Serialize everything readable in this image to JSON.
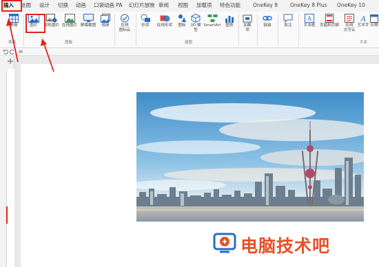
{
  "tabs": [
    {
      "label": "插入",
      "active": true
    },
    {
      "label": "绘图",
      "active": false
    },
    {
      "label": "设计",
      "active": false
    },
    {
      "label": "切换",
      "active": false
    },
    {
      "label": "动画",
      "active": false
    },
    {
      "label": "口袋动画 PA",
      "active": false
    },
    {
      "label": "幻灯片放映",
      "active": false
    },
    {
      "label": "审阅",
      "active": false
    },
    {
      "label": "视图",
      "active": false
    },
    {
      "label": "加载项",
      "active": false
    },
    {
      "label": "特色功能",
      "active": false
    },
    {
      "label": "OneKey 8",
      "active": false
    },
    {
      "label": "OneKey 8 Plus",
      "active": false
    },
    {
      "label": "OneKey 10",
      "active": false
    }
  ],
  "ribbon": {
    "buttons": [
      {
        "label": "表格",
        "icon": "table-icon"
      },
      {
        "label": "图片",
        "icon": "picture-icon"
      },
      {
        "label": "联机图片",
        "icon": "online-picture-icon"
      },
      {
        "label": "在线图片",
        "icon": "online-image-icon"
      },
      {
        "label": "屏幕截图",
        "icon": "screenshot-icon"
      },
      {
        "label": "相册",
        "icon": "album-icon"
      },
      {
        "label": "在线",
        "label2": "图标云",
        "icon": "icon-cloud-icon"
      },
      {
        "label": "形状",
        "icon": "shapes-icon"
      },
      {
        "label": "在线形状",
        "icon": "online-shapes-icon"
      },
      {
        "label": "图标",
        "icon": "icons-icon"
      },
      {
        "label": "3D 模",
        "label2": "型",
        "icon": "3d-model-icon"
      },
      {
        "label": "SmartArt",
        "icon": "smartart-icon"
      },
      {
        "label": "图表",
        "icon": "chart-icon"
      },
      {
        "label": "加载",
        "label2": "项",
        "icon": "addin-icon"
      },
      {
        "label": "链接",
        "icon": "link-icon"
      },
      {
        "label": "批注",
        "icon": "comment-icon"
      },
      {
        "label": "文本框",
        "icon": "textbox-icon"
      },
      {
        "label": "页眉和页脚",
        "icon": "header-footer-icon"
      },
      {
        "label": "在线",
        "label2": "文字云",
        "icon": "word-cloud-icon"
      },
      {
        "label": "艺术字",
        "icon": "wordart-icon"
      },
      {
        "label": "日期",
        "icon": "date-icon"
      }
    ],
    "groups": {
      "table": "表格",
      "images": "图像",
      "illustrations": "插图",
      "text": "文本"
    }
  },
  "watermark": {
    "text": "电脑技术吧"
  },
  "colors": {
    "accent": "#e0221b",
    "ribbon_blue": "#2b6cc4",
    "watermark": "#e8502a"
  }
}
